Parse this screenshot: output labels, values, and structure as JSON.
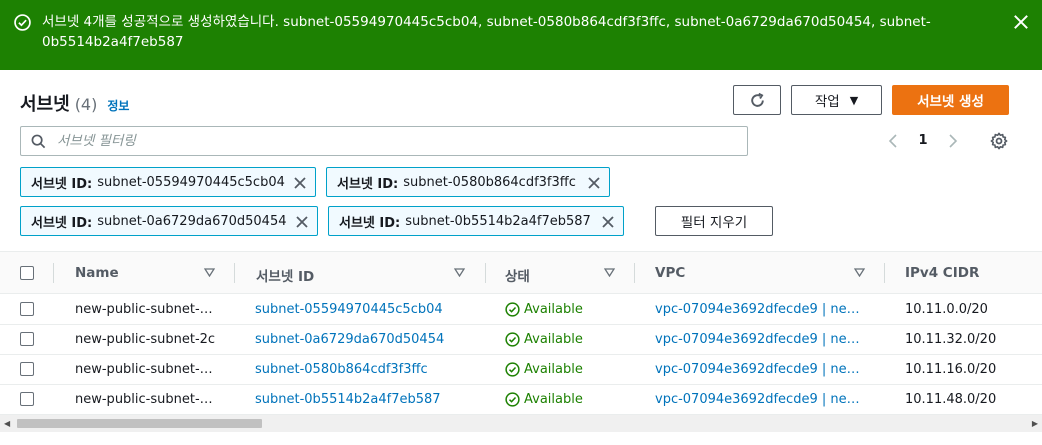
{
  "flash": {
    "message": "서브넷 4개를 성공적으로 생성하였습니다. subnet-05594970445c5cb04, subnet-0580b864cdf3f3ffc, subnet-0a6729da670d50454, subnet-0b5514b2a4f7eb587",
    "icon": "check-circle-icon",
    "close_icon": "close-icon",
    "color": "#1d8102"
  },
  "header": {
    "title": "서브넷",
    "count": "(4)",
    "info_link": "정보"
  },
  "toolbar": {
    "refresh_icon": "refresh-icon",
    "actions_label": "작업",
    "create_label": "서브넷 생성",
    "create_color": "#ec7211"
  },
  "search": {
    "placeholder": "서브넷 필터링",
    "value": ""
  },
  "pagination": {
    "current_page": "1"
  },
  "filters": {
    "tokens": [
      {
        "key": "서브넷 ID:",
        "value": "subnet-05594970445c5cb04"
      },
      {
        "key": "서브넷 ID:",
        "value": "subnet-0580b864cdf3f3ffc"
      },
      {
        "key": "서브넷 ID:",
        "value": "subnet-0a6729da670d50454"
      },
      {
        "key": "서브넷 ID:",
        "value": "subnet-0b5514b2a4f7eb587"
      }
    ],
    "clear_label": "필터 지우기"
  },
  "table": {
    "columns": [
      "Name",
      "서브넷 ID",
      "상태",
      "VPC",
      "IPv4 CIDR"
    ],
    "rows": [
      {
        "name": "new-public-subnet-…",
        "subnet_id": "subnet-05594970445c5cb04",
        "status": "Available",
        "vpc": "vpc-07094e3692dfecde9 | ne…",
        "cidr": "10.11.0.0/20"
      },
      {
        "name": "new-public-subnet-2c",
        "subnet_id": "subnet-0a6729da670d50454",
        "status": "Available",
        "vpc": "vpc-07094e3692dfecde9 | ne…",
        "cidr": "10.11.32.0/20"
      },
      {
        "name": "new-public-subnet-…",
        "subnet_id": "subnet-0580b864cdf3f3ffc",
        "status": "Available",
        "vpc": "vpc-07094e3692dfecde9 | ne…",
        "cidr": "10.11.16.0/20"
      },
      {
        "name": "new-public-subnet-…",
        "subnet_id": "subnet-0b5514b2a4f7eb587",
        "status": "Available",
        "vpc": "vpc-07094e3692dfecde9 | ne…",
        "cidr": "10.11.48.0/20"
      }
    ],
    "status_color": "#1d8102",
    "link_color": "#0073bb"
  }
}
